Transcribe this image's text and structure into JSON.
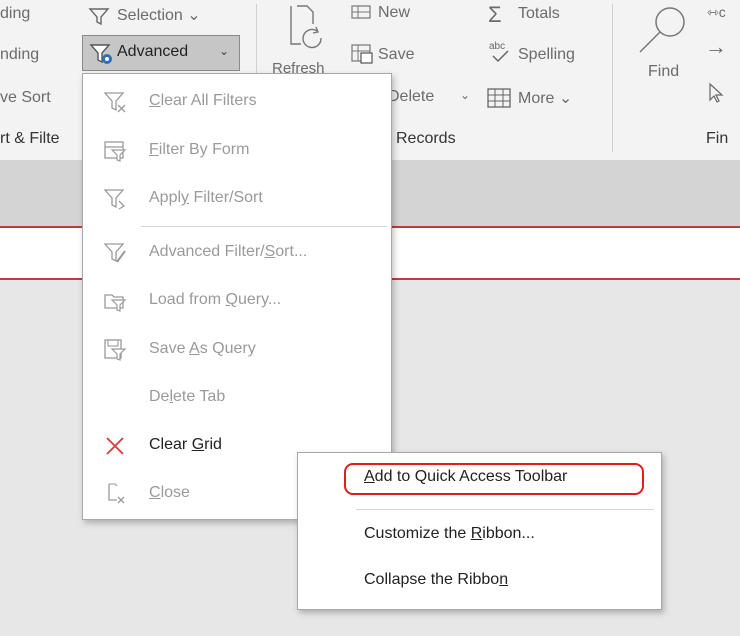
{
  "ribbon": {
    "sort_filter": {
      "row1": "ding",
      "row2": "nding",
      "row3": "ve Sort",
      "group_label": "rt & Filte"
    },
    "selection_label": "Selection",
    "advanced_label": "Advanced",
    "refresh_label": "Refresh",
    "records": {
      "new_label": "New",
      "save_label": "Save",
      "delete_label": "Delete",
      "totals_label": "Totals",
      "spelling_label": "Spelling",
      "more_label": "More",
      "group_label": "Records"
    },
    "find": {
      "find_label": "Find",
      "group_label": "Fin"
    }
  },
  "advanced_menu": {
    "items": [
      {
        "name": "clear-all-filters",
        "pre": "",
        "ul": "C",
        "post": "lear All Filters",
        "icon": "clear-filter-icon",
        "enabled": false
      },
      {
        "name": "filter-by-form",
        "pre": "",
        "ul": "F",
        "post": "ilter By Form",
        "icon": "filter-form-icon",
        "enabled": false
      },
      {
        "name": "apply-filter-sort",
        "pre": "Appl",
        "ul": "y",
        "post": " Filter/Sort",
        "icon": "apply-filter-icon",
        "enabled": false
      },
      {
        "name": "advanced-filter-sort",
        "pre": "Advanced Filter/",
        "ul": "S",
        "post": "ort...",
        "icon": "advanced-filter-icon",
        "enabled": false
      },
      {
        "name": "load-from-query",
        "pre": "Load from ",
        "ul": "Q",
        "post": "uery...",
        "icon": "load-query-icon",
        "enabled": false
      },
      {
        "name": "save-as-query",
        "pre": "Save ",
        "ul": "A",
        "post": "s Query",
        "icon": "save-query-icon",
        "enabled": false
      },
      {
        "name": "delete-tab",
        "pre": "De",
        "ul": "l",
        "post": "ete Tab",
        "icon": "",
        "enabled": false
      },
      {
        "name": "clear-grid",
        "pre": "Clear ",
        "ul": "G",
        "post": "rid",
        "icon": "red-x-icon",
        "enabled": true
      },
      {
        "name": "close",
        "pre": "",
        "ul": "C",
        "post": "lose",
        "icon": "close-grid-icon",
        "enabled": false
      }
    ]
  },
  "context_menu": {
    "items": [
      {
        "pre": "",
        "ul": "A",
        "post": "dd to Quick Access Toolbar"
      },
      {
        "pre": "Customize the ",
        "ul": "R",
        "post": "ibbon..."
      },
      {
        "pre": "Collapse the Ribbo",
        "ul": "n",
        "post": ""
      }
    ]
  },
  "colors": {
    "highlight": "#e21d1d",
    "clear_grid_x": "#d93a3a",
    "accent_red_line": "#b64040"
  }
}
